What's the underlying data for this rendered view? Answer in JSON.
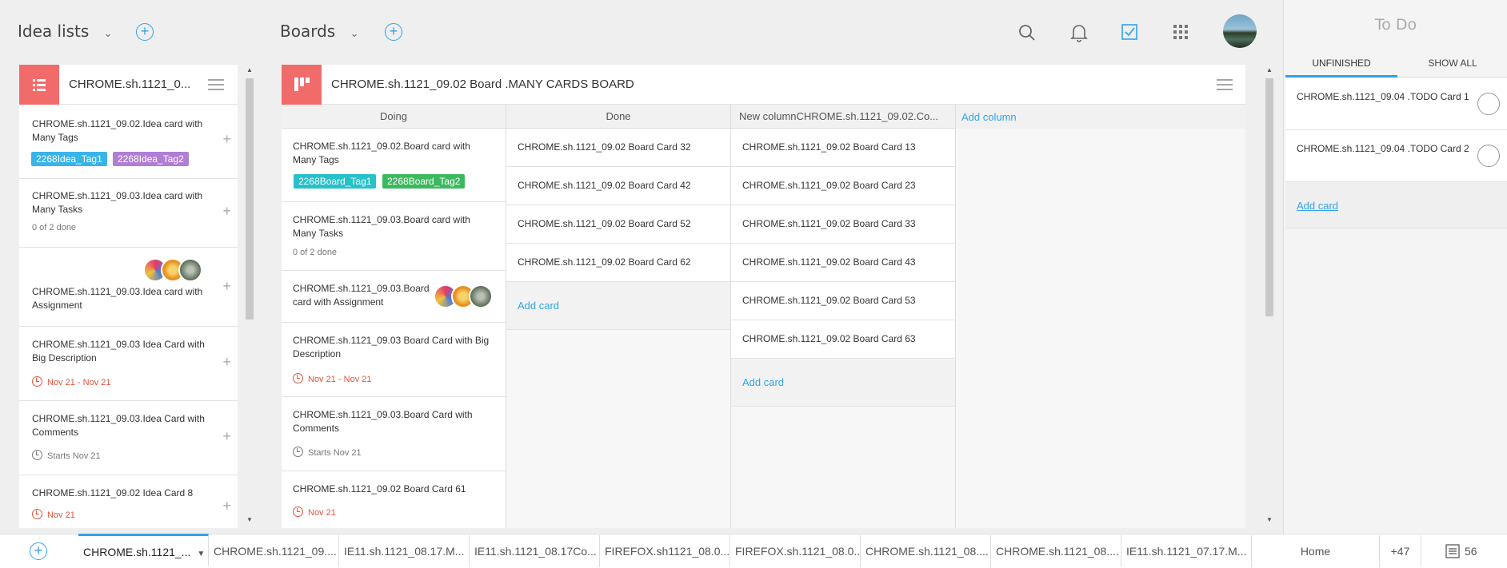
{
  "header": {
    "idea_lists_label": "Idea lists",
    "boards_label": "Boards"
  },
  "idea_list": {
    "title": "CHROME.sh.1121_0...",
    "cards": [
      {
        "title_l1": "CHROME.sh.1121_09.02.Idea card with",
        "title_l2": "Many Tags",
        "tags": [
          "2268Idea_Tag1",
          "2268Idea_Tag2"
        ]
      },
      {
        "title_l1": "CHROME.sh.1121_09.03.Idea card with",
        "title_l2": "Many Tasks",
        "sub": "0 of 2 done"
      },
      {
        "title_l1": "CHROME.sh.1121_09.03.Idea card with",
        "title_l2": "Assignment"
      },
      {
        "title_l1": "CHROME.sh.1121_09.03 Idea Card with",
        "title_l2": "Big Description",
        "date": "Nov 21 - Nov 21"
      },
      {
        "title_l1": "CHROME.sh.1121_09.03.Idea Card with",
        "title_l2": "Comments",
        "date": "Starts Nov 21"
      },
      {
        "title_l1": "CHROME.sh.1121_09.02 Idea Card 8",
        "date": "Nov 21"
      }
    ]
  },
  "board": {
    "title": "CHROME.sh.1121_09.02 Board .MANY CARDS BOARD",
    "add_column": "Add column",
    "add_card": "Add card",
    "columns": [
      {
        "name": "Doing",
        "cards": [
          {
            "l1": "CHROME.sh.1121_09.02.Board card with",
            "l2": "Many Tags",
            "tags": [
              "2268Board_Tag1",
              "2268Board_Tag2"
            ]
          },
          {
            "l1": "CHROME.sh.1121_09.03.Board card with",
            "l2": "Many Tasks",
            "sub": "0 of 2 done"
          },
          {
            "l1": "CHROME.sh.1121_09.03.Board",
            "l2": "card with Assignment"
          },
          {
            "l1": "CHROME.sh.1121_09.03 Board Card with Big",
            "l2": "Description",
            "date": "Nov 21 - Nov 21"
          },
          {
            "l1": "CHROME.sh.1121_09.03.Board Card with",
            "l2": "Comments",
            "date": "Starts Nov 21"
          },
          {
            "l1": "CHROME.sh.1121_09.02 Board Card 61",
            "date": "Nov 21"
          }
        ]
      },
      {
        "name": "Done",
        "cards": [
          "CHROME.sh.1121_09.02 Board Card 32",
          "CHROME.sh.1121_09.02 Board Card 42",
          "CHROME.sh.1121_09.02 Board Card 52",
          "CHROME.sh.1121_09.02 Board Card 62"
        ]
      },
      {
        "name": "New columnCHROME.sh.1121_09.02.Co...",
        "cards": [
          "CHROME.sh.1121_09.02 Board Card 13",
          "CHROME.sh.1121_09.02 Board Card 23",
          "CHROME.sh.1121_09.02 Board Card 33",
          "CHROME.sh.1121_09.02 Board Card 43",
          "CHROME.sh.1121_09.02 Board Card 53",
          "CHROME.sh.1121_09.02 Board Card 63"
        ]
      }
    ]
  },
  "todo": {
    "title": "To Do",
    "tab_unfinished": "UNFINISHED",
    "tab_show_all": "SHOW ALL",
    "items": [
      "CHROME.sh.1121_09.04 .TODO Card 1",
      "CHROME.sh.1121_09.04 .TODO Card 2"
    ],
    "add_card": "Add card"
  },
  "bottom_tabs": [
    "CHROME.sh.1121_...",
    "CHROME.sh.1121_09....",
    "IE11.sh.1121_08.17.M...",
    "IE11.sh.1121_08.17Co...",
    "FIREFOX.sh1121_08.0...",
    "FIREFOX.sh.1121_08.0...",
    "CHROME.sh.1121_08....",
    "CHROME.sh.1121_08....",
    "IE11.sh.1121_07.17.M..."
  ],
  "bottom_bar": {
    "home": "Home",
    "more_count": "+47",
    "list_count": "56"
  },
  "colors": {
    "accent": "#2fa4e7",
    "board_icon": "#f26b6b",
    "date_red": "#e2533c"
  }
}
